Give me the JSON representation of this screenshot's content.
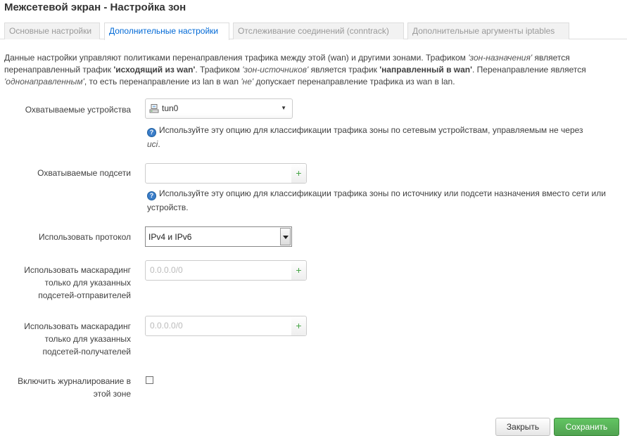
{
  "page": {
    "title": "Межсетевой экран - Настройка зон"
  },
  "tabs": [
    {
      "label": "Основные настройки",
      "active": false
    },
    {
      "label": "Дополнительные настройки",
      "active": true
    },
    {
      "label": "Отслеживание соединений (conntrack)",
      "active": false
    },
    {
      "label": "Дополнительные аргументы iptables",
      "active": false
    }
  ],
  "description": {
    "t1": "Данные настройки управляют политиками перенаправления трафика между этой (wan) и другими зонами. Трафиком ",
    "e1": "'зон-назначения'",
    "t2": " является перенаправленный трафик ",
    "b1": "'исходящий из wan'",
    "t3": ". Трафиком ",
    "e2": "'зон-источников'",
    "t4": " является трафик ",
    "b2": "'направленный в wan'",
    "t5": ". Перенаправление является ",
    "e3": "'однонаправленным'",
    "t6": ", то есть перенаправление из lan в wan ",
    "e4": "'не'",
    "t7": " допускает перенаправление трафика из wan в lan."
  },
  "fields": {
    "devices": {
      "label": "Охватываемые устройства",
      "value": "tun0",
      "help": "Используйте эту опцию для классификации трафика зоны по сетевым устройствам, управляемым не через",
      "help_em": "uci",
      "help_end": "."
    },
    "subnets": {
      "label": "Охватываемые подсети",
      "value": "",
      "help": "Используйте эту опцию для классификации трафика зоны по источнику или подсети назначения вместо сети или устройств."
    },
    "protocol": {
      "label": "Использовать протокол",
      "value": "IPv4 и IPv6"
    },
    "masq_src": {
      "label_l1": "Использовать маскарадинг",
      "label_l2": "только для указанных",
      "label_l3": "подсетей-отправителей",
      "placeholder": "0.0.0.0/0"
    },
    "masq_dest": {
      "label_l1": "Использовать маскарадинг",
      "label_l2": "только для указанных",
      "label_l3": "подсетей-получателей",
      "placeholder": "0.0.0.0/0"
    },
    "logging": {
      "label_l1": "Включить журналирование в",
      "label_l2": "этой зоне",
      "checked": false
    }
  },
  "icons": {
    "help": "help-icon",
    "device": "network-device-icon",
    "add": "plus-icon",
    "dropdown": "chevron-down-icon"
  },
  "buttons": {
    "close": "Закрыть",
    "save": "Сохранить"
  },
  "colors": {
    "active_tab": "#0069d6",
    "save_button": "#51a351",
    "help_icon": "#3a7dc9"
  }
}
